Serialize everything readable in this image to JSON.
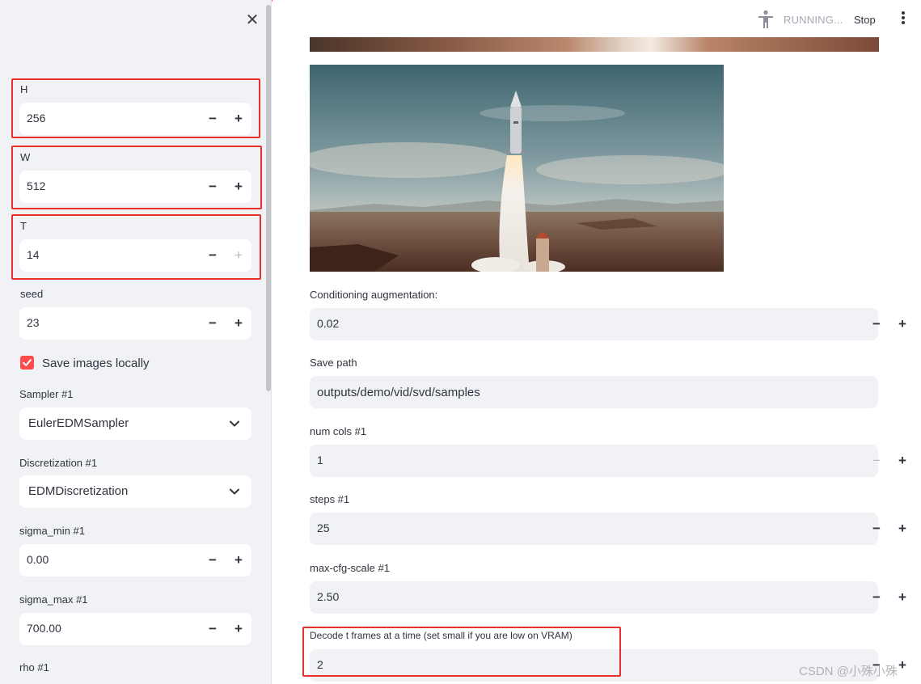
{
  "sidebar": {
    "close_icon": "close-icon",
    "fields": {
      "h": {
        "label": "H",
        "value": "256"
      },
      "w": {
        "label": "W",
        "value": "512"
      },
      "t": {
        "label": "T",
        "value": "14"
      },
      "seed": {
        "label": "seed",
        "value": "23"
      },
      "sigma_min": {
        "label": "sigma_min #1",
        "value": "0.00"
      },
      "sigma_max": {
        "label": "sigma_max #1",
        "value": "700.00"
      },
      "rho": {
        "label": "rho #1"
      }
    },
    "save_images": {
      "label": "Save images locally",
      "checked": true
    },
    "sampler": {
      "label": "Sampler #1",
      "value": "EulerEDMSampler"
    },
    "discretization": {
      "label": "Discretization #1",
      "value": "EDMDiscretization"
    },
    "stepper_minus": "−",
    "stepper_plus": "+"
  },
  "header": {
    "status": "RUNNING...",
    "stop_label": "Stop",
    "status_icon": "running-person-icon",
    "menu_icon": "kebab-menu-icon"
  },
  "main": {
    "conditioning": {
      "label": "Conditioning augmentation:",
      "value": "0.02"
    },
    "save_path": {
      "label": "Save path",
      "value": "outputs/demo/vid/svd/samples"
    },
    "num_cols": {
      "label": "num cols #1",
      "value": "1"
    },
    "steps": {
      "label": "steps #1",
      "value": "25"
    },
    "max_cfg": {
      "label": "max-cfg-scale #1",
      "value": "2.50"
    },
    "decode": {
      "label": "Decode t frames at a time (set small if you are low on VRAM)",
      "value": "2"
    }
  },
  "watermark": "CSDN @小殊小殊",
  "colors": {
    "accent": "#ff4b4b",
    "highlight": "#e8312f",
    "sidebar_bg": "#f0f2f6"
  }
}
